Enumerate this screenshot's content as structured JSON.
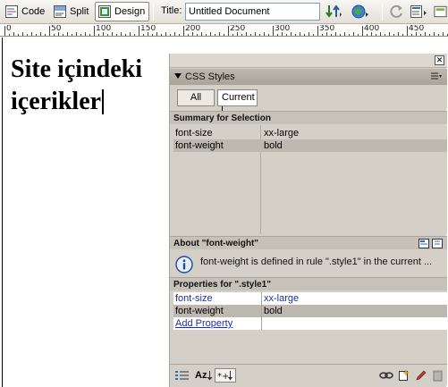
{
  "toolbar": {
    "code_label": "Code",
    "split_label": "Split",
    "design_label": "Design",
    "title_label": "Title:",
    "title_value": "Untitled Document",
    "icons": [
      "file-management-icon",
      "preview-browser-icon",
      "refresh-icon",
      "view-options-icon",
      "visual-aids-icon"
    ]
  },
  "ruler": {
    "labels": [
      "0",
      "50",
      "100",
      "150",
      "200",
      "250",
      "300",
      "350",
      "400",
      "450"
    ]
  },
  "document": {
    "heading": "Site içindeki içerikler"
  },
  "panel": {
    "title": "CSS Styles",
    "tabs": {
      "all": "All",
      "current": "Current"
    },
    "summary": {
      "header": "Summary for Selection",
      "rows": [
        {
          "property": "font-size",
          "value": "xx-large",
          "selected": false
        },
        {
          "property": "font-weight",
          "value": "bold",
          "selected": true
        }
      ]
    },
    "about": {
      "header": "About \"font-weight\"",
      "text": "font-weight is defined in rule \".style1\" in the current ..."
    },
    "properties": {
      "header": "Properties for \".style1\"",
      "rows": [
        {
          "property": "font-size",
          "value": "xx-large"
        },
        {
          "property": "font-weight",
          "value": "bold"
        }
      ],
      "add_label": "Add Property"
    },
    "bottom_icons": [
      "category-view-icon",
      "alphabetical-view-icon",
      "set-properties-view-icon",
      "attach-stylesheet-icon",
      "new-css-rule-icon",
      "edit-style-icon",
      "delete-css-rule-icon"
    ],
    "sort_label": "Az"
  }
}
